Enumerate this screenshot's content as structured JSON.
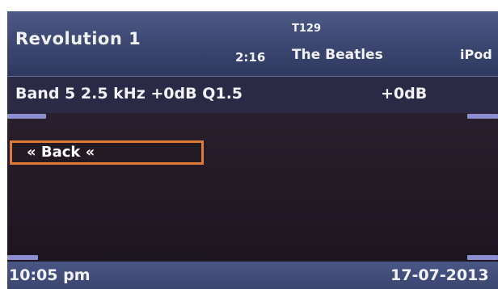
{
  "header": {
    "title": "Revolution 1",
    "elapsed": "2:16",
    "track_number": "T129",
    "artist": "The Beatles",
    "source": "iPod"
  },
  "equalizer": {
    "band_info": "Band 5 2.5 kHz +0dB Q1.5",
    "gain": "+0dB"
  },
  "menu": {
    "back_label": "« Back «"
  },
  "footer": {
    "time": "10:05 pm",
    "date": "17-07-2013"
  },
  "colors": {
    "header_bg": "#3a4670",
    "body_bg": "#1e1620",
    "eq_row_bg": "#2a2a46",
    "selection_border": "#e07a38",
    "scroll_marker": "#8e8fd2",
    "text": "#f2f2f6"
  }
}
